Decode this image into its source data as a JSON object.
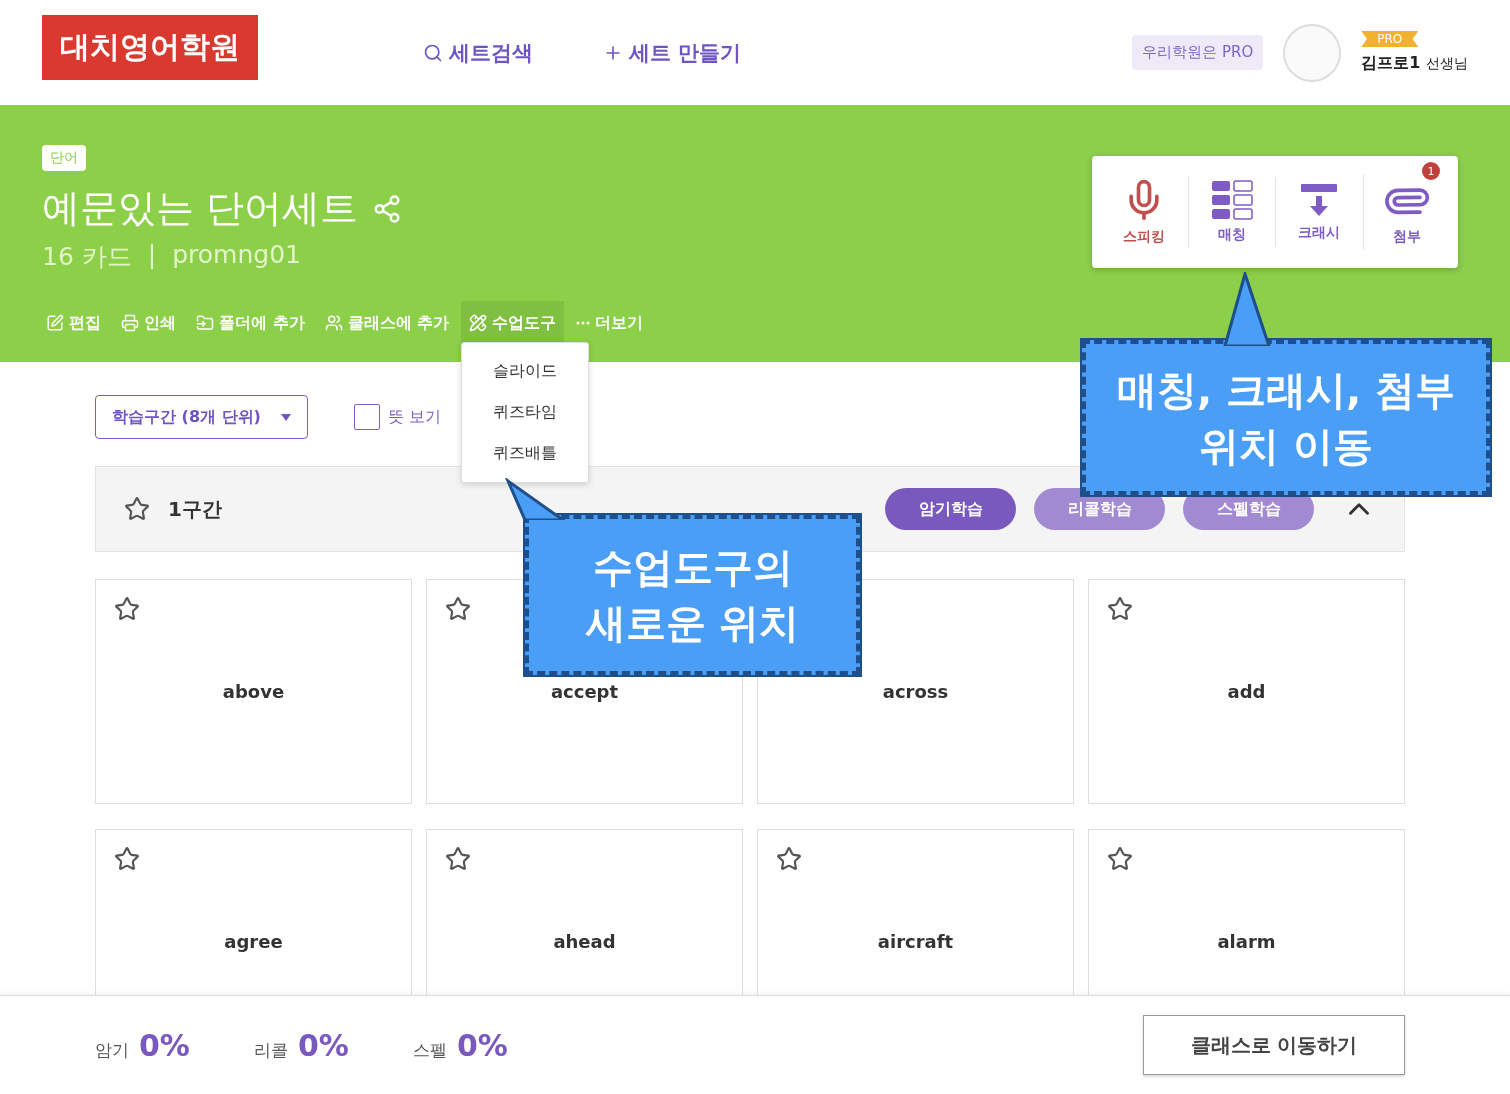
{
  "header": {
    "logo": "대치영어학원",
    "nav": [
      {
        "kind": "search",
        "label": "세트검색"
      },
      {
        "kind": "plus",
        "label": "세트 만들기"
      }
    ],
    "pro_bubble": "우리학원은 PRO",
    "profile": {
      "badge": "PRO",
      "name": "김프로1",
      "suffix": "선생님"
    }
  },
  "set": {
    "tag": "단어",
    "title": "예문있는 단어세트",
    "count": "16 카드",
    "separator": "|",
    "author": "promng01"
  },
  "tools": [
    {
      "kind": "mic",
      "label": "스피킹",
      "color": "#c0504d"
    },
    {
      "kind": "matching",
      "label": "매칭",
      "color": "#7e5cc4"
    },
    {
      "kind": "crash",
      "label": "크래시",
      "color": "#7e5cc4"
    },
    {
      "kind": "clip",
      "label": "첨부",
      "color": "#7e5cc4",
      "badge": "1"
    }
  ],
  "actions": [
    {
      "kind": "edit",
      "label": "편집",
      "expanded": false
    },
    {
      "kind": "print",
      "label": "인쇄",
      "expanded": false
    },
    {
      "kind": "folder",
      "label": "폴더에 추가",
      "expanded": false
    },
    {
      "kind": "class",
      "label": "클래스에 추가",
      "expanded": false
    },
    {
      "kind": "tool",
      "label": "수업도구",
      "expanded": true
    },
    {
      "kind": "more",
      "label": "더보기",
      "expanded": false
    }
  ],
  "tool_menu": [
    "슬라이드",
    "퀴즈타임",
    "퀴즈배틀"
  ],
  "filter": {
    "range": "학습구간 (8개 단위)",
    "meaning": {
      "label": "뜻 보기",
      "checked": false
    }
  },
  "section": {
    "title": "1구간",
    "expanded": true,
    "modes": [
      {
        "label": "암기학습",
        "selected": true
      },
      {
        "label": "리콜학습",
        "selected": false
      },
      {
        "label": "스펠학습",
        "selected": false
      }
    ]
  },
  "cards": [
    {
      "word": "above"
    },
    {
      "word": "accept"
    },
    {
      "word": "across"
    },
    {
      "word": "add"
    },
    {
      "word": "agree"
    },
    {
      "word": "ahead"
    },
    {
      "word": "aircraft"
    },
    {
      "word": "alarm"
    }
  ],
  "stats": [
    {
      "label": "암기",
      "value": "0%"
    },
    {
      "label": "리콜",
      "value": "0%"
    },
    {
      "label": "스펠",
      "value": "0%"
    }
  ],
  "footer_button": "클래스로 이동하기",
  "callouts": [
    {
      "kind": "tools",
      "lines": [
        "매칭, 크래시, 첨부",
        "위치 이동"
      ]
    },
    {
      "kind": "menu",
      "lines": [
        "수업도구의",
        "새로운 위치"
      ]
    }
  ]
}
